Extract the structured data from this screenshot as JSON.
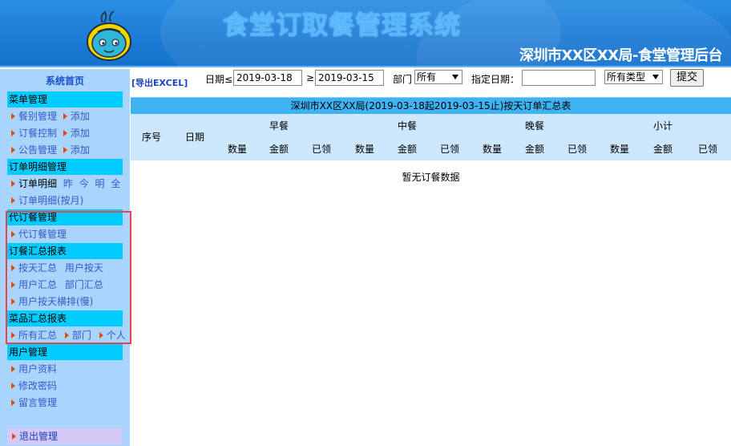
{
  "header": {
    "system_title": "食堂订取餐管理系统",
    "org_title": "深圳市XX区XX局-食堂管理后台"
  },
  "sidebar": {
    "home": "系统首页",
    "sections": [
      {
        "title": "菜单管理",
        "rows": [
          {
            "items": [
              "餐别管理",
              "添加"
            ]
          },
          {
            "items": [
              "订餐控制",
              "添加"
            ]
          },
          {
            "items": [
              "公告管理",
              "添加"
            ]
          }
        ]
      },
      {
        "title": "订单明细管理",
        "rows": [
          {
            "items": [
              "订单明细",
              "昨",
              "今",
              "明",
              "全"
            ]
          },
          {
            "items": [
              "订单明细(按月)"
            ]
          }
        ]
      },
      {
        "title": "代订餐管理",
        "rows": [
          {
            "items": [
              "代订餐管理"
            ]
          }
        ]
      },
      {
        "title": "订餐汇总报表",
        "rows": [
          {
            "items": [
              "按天汇总",
              "用户按天"
            ]
          },
          {
            "items": [
              "用户汇总",
              "部门汇总"
            ]
          },
          {
            "items": [
              "用户按天横排(慢)"
            ]
          }
        ]
      },
      {
        "title": "菜品汇总报表",
        "rows": [
          {
            "items": [
              "所有汇总",
              "部门",
              "个人"
            ]
          }
        ]
      },
      {
        "title": "用户管理",
        "rows": [
          {
            "items": [
              "用户资料"
            ]
          },
          {
            "items": [
              "修改密码"
            ]
          },
          {
            "items": [
              "留言管理"
            ]
          }
        ]
      }
    ],
    "logout": "退出管理"
  },
  "toolbar": {
    "export": "[导出EXCEL]",
    "date_le_label": "日期≤",
    "date_le_value": "2019-03-18",
    "date_ge_label": "≥",
    "date_ge_value": "2019-03-15",
    "dept_label": "部门",
    "dept_value": "所有",
    "specified_date_label": "指定日期：",
    "specified_date_value": "",
    "type_value": "所有类型",
    "query_button": "提交"
  },
  "report": {
    "title": "深圳市XX区XX局(2019-03-18起2019-03-15止)按天订单汇总表",
    "col_seq": "序号",
    "col_date": "日期",
    "meal_groups": [
      "早餐",
      "中餐",
      "晚餐",
      "小计"
    ],
    "sub_cols": [
      "数量",
      "金额",
      "已领"
    ],
    "empty_message": "暂无订餐数据"
  }
}
